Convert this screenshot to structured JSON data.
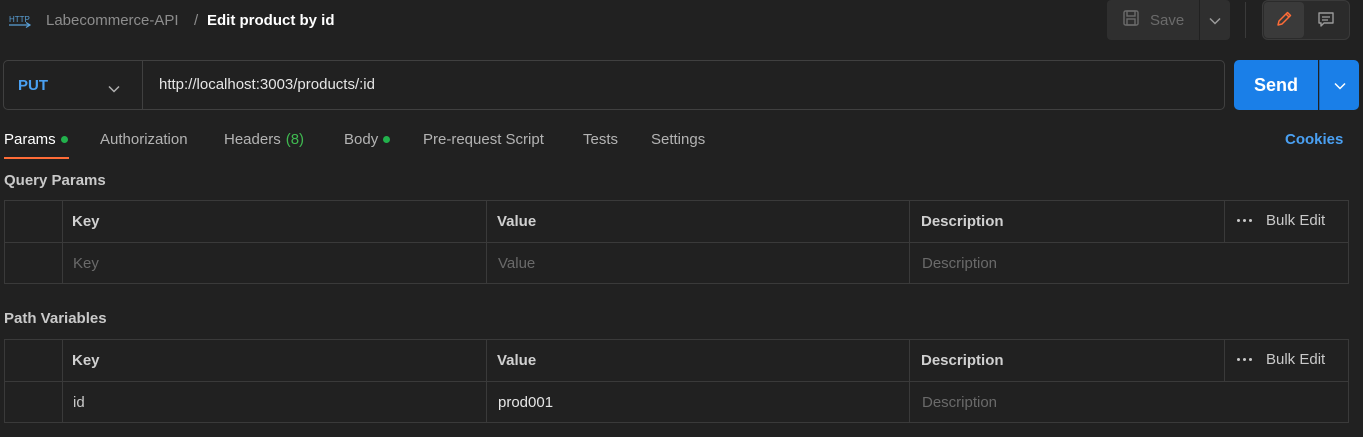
{
  "header": {
    "collection": "Labecommerce-API",
    "separator": "/",
    "title": "Edit product by id",
    "save_label": "Save"
  },
  "request": {
    "method": "PUT",
    "url": "http://localhost:3003/products/:id",
    "send_label": "Send"
  },
  "tabs": [
    {
      "label": "Params",
      "active": true,
      "dot": true
    },
    {
      "label": "Authorization"
    },
    {
      "label": "Headers",
      "count": "(8)"
    },
    {
      "label": "Body",
      "dot": true
    },
    {
      "label": "Pre-request Script"
    },
    {
      "label": "Tests"
    },
    {
      "label": "Settings"
    }
  ],
  "cookies_label": "Cookies",
  "query_params": {
    "title": "Query Params",
    "headers": {
      "key": "Key",
      "value": "Value",
      "description": "Description",
      "bulk_edit": "Bulk Edit"
    },
    "placeholders": {
      "key": "Key",
      "value": "Value",
      "description": "Description"
    }
  },
  "path_variables": {
    "title": "Path Variables",
    "headers": {
      "key": "Key",
      "value": "Value",
      "description": "Description",
      "bulk_edit": "Bulk Edit"
    },
    "rows": [
      {
        "key": "id",
        "value": "prod001",
        "description_placeholder": "Description"
      }
    ]
  },
  "colors": {
    "accent": "#ff6c37",
    "send": "#1a7fe8",
    "method": "#4aa0f2",
    "dot": "#22b14c"
  },
  "icons": [
    "http-icon",
    "save-icon",
    "chevron-down-icon",
    "pencil-icon",
    "comment-icon",
    "more-dots-icon"
  ]
}
